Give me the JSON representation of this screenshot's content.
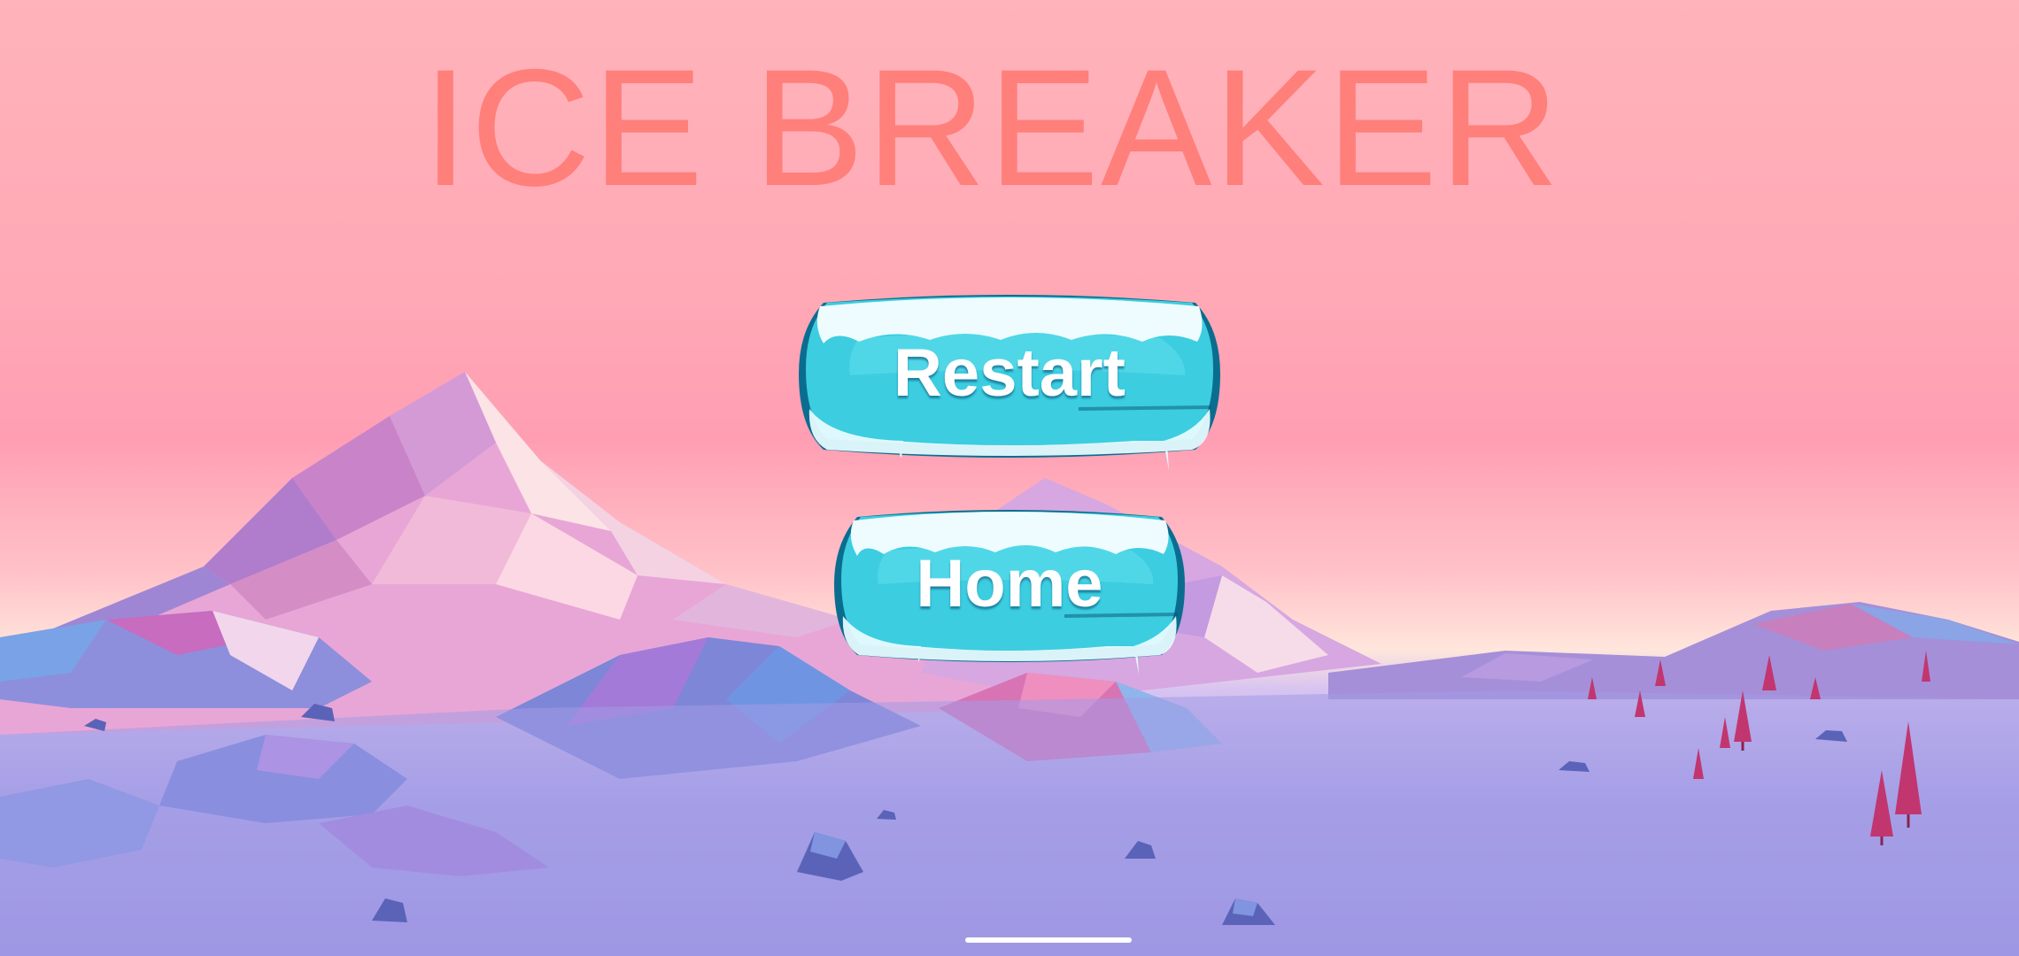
{
  "game": {
    "title": "ICE BREAKER",
    "title_color": "#ff7f7a"
  },
  "buttons": {
    "restart_label": "Restart",
    "home_label": "Home"
  },
  "theme": {
    "sky_top": "#ffb3ba",
    "sky_horizon": "#ffe6dc",
    "ground": "#9a92e0",
    "button_ice": "#3ccde0",
    "button_rim": "#0a6d8f",
    "tree": "#c2366f"
  },
  "scene": {
    "background": "low-poly-snowy-mountains",
    "decor_icons": [
      "mountain-peak-icon",
      "rock-icon",
      "pine-tree-icon"
    ]
  }
}
